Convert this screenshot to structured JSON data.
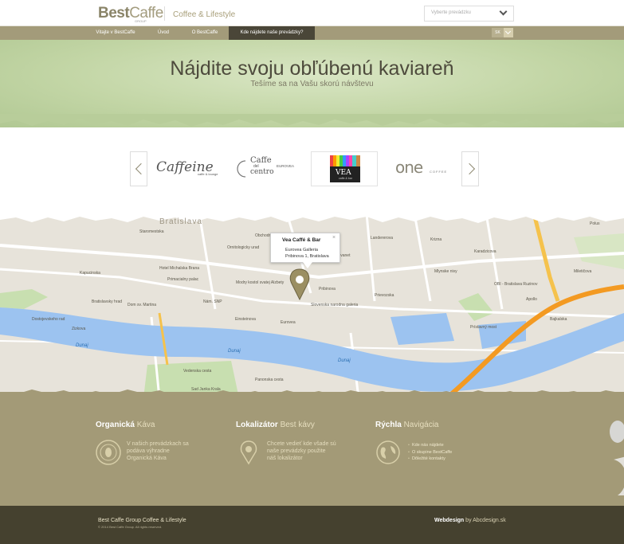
{
  "header": {
    "logo_best": "Best",
    "logo_caffe": "Caffe",
    "logo_sub": "GROUP",
    "tagline": "Coffee & Lifestyle",
    "select_placeholder": "Vyberte prevádzku"
  },
  "nav": {
    "items": [
      {
        "label": "Vitajte v BestCaffe"
      },
      {
        "label": "Úvod"
      },
      {
        "label": "O BestCaffe"
      },
      {
        "label": "Kde nájdete naše prevádzky?"
      }
    ],
    "lang": "SK"
  },
  "hero": {
    "title": "Nájdite svoju obľúbenú kaviareň",
    "subtitle": "Tešíme sa na Vašu skorú návštevu"
  },
  "brands": {
    "caffeine": "Caffeine",
    "caffeine_sub": "caffe & lounge",
    "centro_a": "Caffe",
    "centro_b": "del",
    "centro_c": "centro",
    "centro_eurovea": "EUROVEA",
    "vea": "VEA",
    "vea_sub": "caffe & bar",
    "one": "one",
    "one_sub": "COFFEE"
  },
  "map": {
    "city": "Bratislava",
    "labels": [
      "Hotel Michalska Brana",
      "Primacialny palac",
      "Modry kostol svatej Alzbety",
      "Ornitologicky urad",
      "Bratislavsky hrad",
      "Dom sv. Martina",
      "Eurovea",
      "Sad Janka Krala",
      "OBI - Bratislava Ruzinov",
      "Mlynske nivy",
      "Prievozska",
      "Dostojevskeho rad",
      "Krizna",
      "Zizkova",
      "Vedenska cesta",
      "Panonska cesta",
      "Einsteinova",
      "Landererova",
      "Karadzicova",
      "Miletičova",
      "Staromestska",
      "Slovenska narodna galeria",
      "Kapucinska",
      "Bajkalska",
      "Prístavný most",
      "Slovanet",
      "Apollo",
      "Polus",
      "Pribinova",
      "Nám. SNP",
      "Obchodna"
    ],
    "rivers": [
      "Dunaj",
      "Dunaj",
      "Dunaj"
    ],
    "popup": {
      "title": "Vea Caffé & Bar",
      "line1": "Eurovea Galleria",
      "line2": "Pribinova 1, Bratislava",
      "close": "×"
    }
  },
  "footer": {
    "col1": {
      "title_strong": "Organická",
      "title_light": "Káva",
      "text": [
        "V našich prevádzkach sa",
        "podáva výhradne",
        "Organická Káva"
      ]
    },
    "col2": {
      "title_strong": "Lokalizátor",
      "title_light": "Best kávy",
      "text": [
        "Chcete vedieť kde všade sú",
        "naše prevádzky použite",
        "náš lokalizátor"
      ]
    },
    "col3": {
      "title_strong": "Rýchla",
      "title_light": "Navigácia",
      "links": [
        "Kde nás nájdete",
        "O skupine BestCaffe",
        "Dôležité kontakty"
      ]
    },
    "copyright": "Best Caffe Group Coffee & Lifestyle",
    "copyright_sub": "© 2014 Best Caffe Group. All rights reserved.",
    "credit_label": "Webdesign",
    "credit_by": "by Abcdesign.sk"
  },
  "colors": {
    "olive": "#a39b7a",
    "dark_olive": "#45412f",
    "hero_green": "#c3d6a6",
    "route_orange": "#f39a22",
    "river_blue": "#9cc3f0"
  }
}
